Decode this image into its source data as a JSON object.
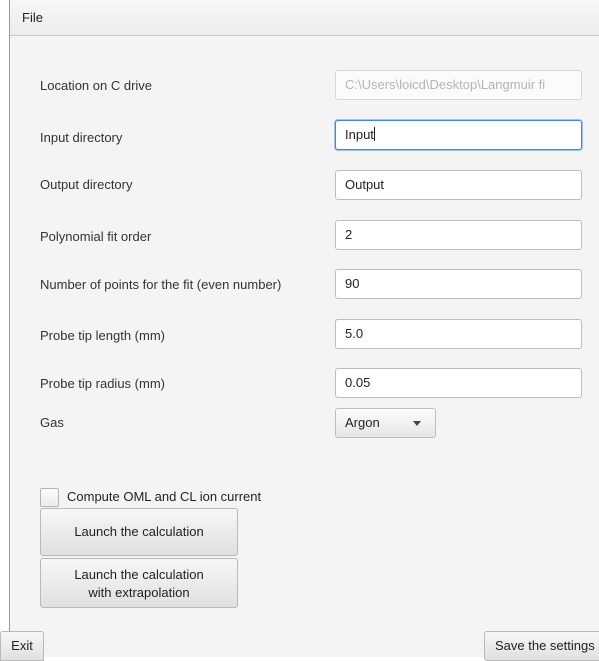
{
  "menubar": {
    "file": "File"
  },
  "form": {
    "location_label": "Location on C drive",
    "location_value": "C:\\Users\\loicd\\Desktop\\Langmuir fi",
    "input_label": "Input directory",
    "input_value": "Input",
    "output_label": "Output directory",
    "output_value": "Output",
    "poly_label": "Polynomial fit order",
    "poly_value": "2",
    "points_label": "Number of points for the fit (even number)",
    "points_value": "90",
    "tip_length_label": "Probe tip length (mm)",
    "tip_length_value": "5.0",
    "tip_radius_label": "Probe tip radius (mm)",
    "tip_radius_value": "0.05",
    "gas_label": "Gas",
    "gas_value": "Argon"
  },
  "options": {
    "compute_label": "Compute OML and CL ion current",
    "compute_checked": false
  },
  "buttons": {
    "launch": "Launch the calculation",
    "launch_extra_line1": "Launch the calculation",
    "launch_extra_line2": "with extrapolation",
    "exit": "Exit",
    "save": "Save the settings"
  }
}
